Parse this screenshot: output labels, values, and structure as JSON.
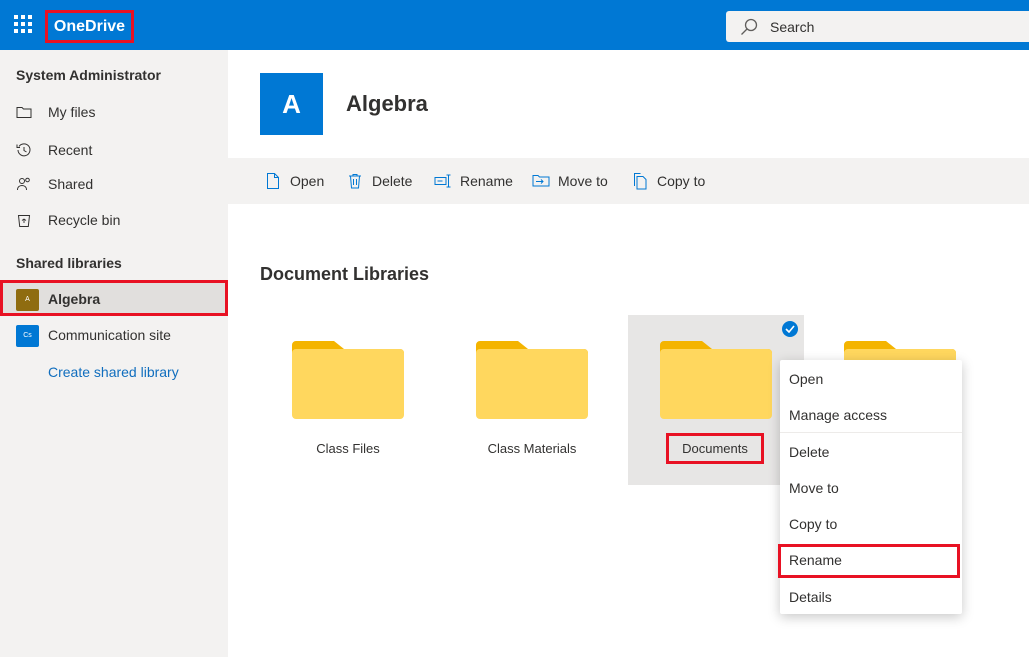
{
  "topbar": {
    "brand": "OneDrive",
    "search_placeholder": "Search"
  },
  "sidebar": {
    "user_name": "System Administrator",
    "nav": [
      {
        "label": "My files",
        "icon": "folder-icon"
      },
      {
        "label": "Recent",
        "icon": "history-icon"
      },
      {
        "label": "Shared",
        "icon": "people-icon"
      },
      {
        "label": "Recycle bin",
        "icon": "recycle-bin-icon"
      }
    ],
    "libraries_heading": "Shared libraries",
    "libraries": [
      {
        "label": "Algebra",
        "badge": "A",
        "color": "#8f6c10",
        "selected": true
      },
      {
        "label": "Communication site",
        "badge": "Cs",
        "color": "#0078d4",
        "selected": false
      }
    ],
    "create_link": "Create shared library"
  },
  "header": {
    "logo_letter": "A",
    "title": "Algebra"
  },
  "commands": [
    {
      "label": "Open",
      "icon": "open-icon"
    },
    {
      "label": "Delete",
      "icon": "trash-icon"
    },
    {
      "label": "Rename",
      "icon": "rename-icon"
    },
    {
      "label": "Move to",
      "icon": "move-icon"
    },
    {
      "label": "Copy to",
      "icon": "copy-icon"
    }
  ],
  "main": {
    "section_title": "Document Libraries",
    "folders": [
      {
        "name": "Class Files",
        "selected": false
      },
      {
        "name": "Class Materials",
        "selected": false
      },
      {
        "name": "Documents",
        "selected": true
      },
      {
        "name": "",
        "selected": false
      }
    ]
  },
  "context_menu": {
    "items": [
      "Open",
      "Manage access",
      "Delete",
      "Move to",
      "Copy to",
      "Rename",
      "Details"
    ],
    "highlighted": "Rename"
  },
  "colors": {
    "brand_blue": "#0078d4",
    "highlight_red": "#e81123",
    "folder_yellow": "#ffd75e",
    "folder_tab": "#f4b400"
  }
}
